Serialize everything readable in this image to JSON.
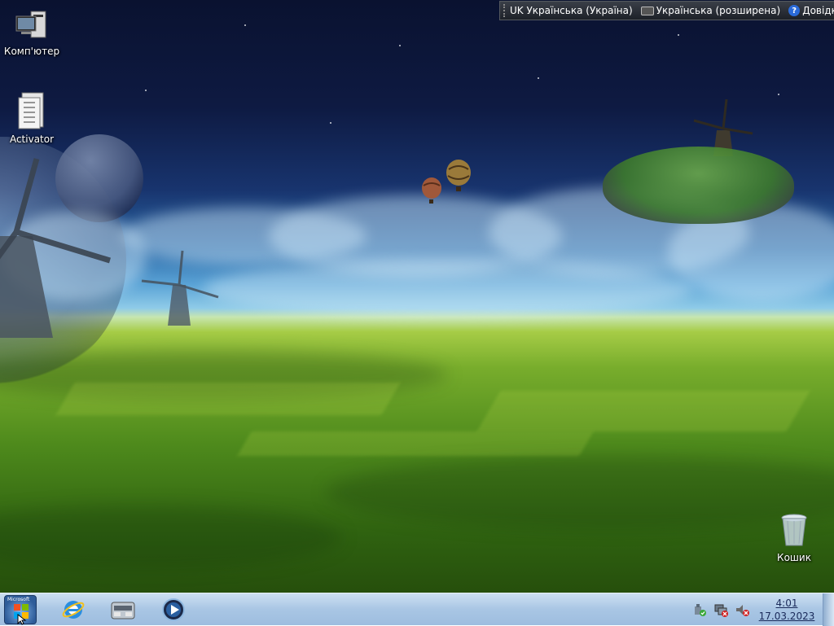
{
  "desktop_icons": [
    {
      "label": "Комп'ютер",
      "icon": "computer-icon"
    },
    {
      "label": "Activator",
      "icon": "file-archive-icon"
    },
    {
      "label": "Кошик",
      "icon": "recycle-bin-icon"
    }
  ],
  "language_bar": {
    "language": "UK Українська (Україна)",
    "keyboard_layout": "Українська (розширена)",
    "help_label": "Довідка"
  },
  "taskbar": {
    "start_label": "Microsoft",
    "pinned_apps": [
      {
        "icon": "internet-explorer-icon"
      },
      {
        "icon": "file-manager-icon"
      },
      {
        "icon": "media-player-icon"
      }
    ],
    "tray_icons": [
      "safely-remove-hardware-icon",
      "network-icon",
      "volume-muted-icon"
    ],
    "clock": {
      "time": "4:01",
      "date": "17.03.2023"
    }
  },
  "colors": {
    "taskbar": "#a9c6e4",
    "lang_bar": "#1d2128",
    "clock_text": "#1a2a5a"
  }
}
